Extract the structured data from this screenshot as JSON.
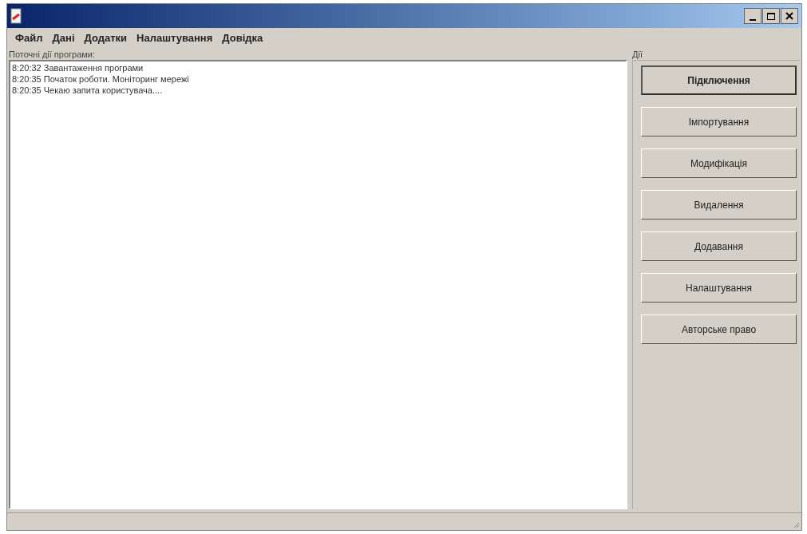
{
  "menu": [
    "Файл",
    "Дані",
    "Додатки",
    "Налаштування",
    "Довідка"
  ],
  "log": {
    "label": "Поточні дії програми:",
    "lines": [
      "8:20:32 Завантаження програми",
      "8:20:35 Початок роботи. Моніторинг мережі",
      "8:20:35 Чекаю запита користувача...."
    ]
  },
  "actions": {
    "label": "Дії",
    "buttons": [
      {
        "label": "Підключення",
        "default": true
      },
      {
        "label": "Імпортування",
        "default": false
      },
      {
        "label": "Модифікація",
        "default": false
      },
      {
        "label": "Видалення",
        "default": false
      },
      {
        "label": "Додавання",
        "default": false
      },
      {
        "label": "Налаштування",
        "default": false
      },
      {
        "label": "Авторське право",
        "default": false
      }
    ]
  }
}
